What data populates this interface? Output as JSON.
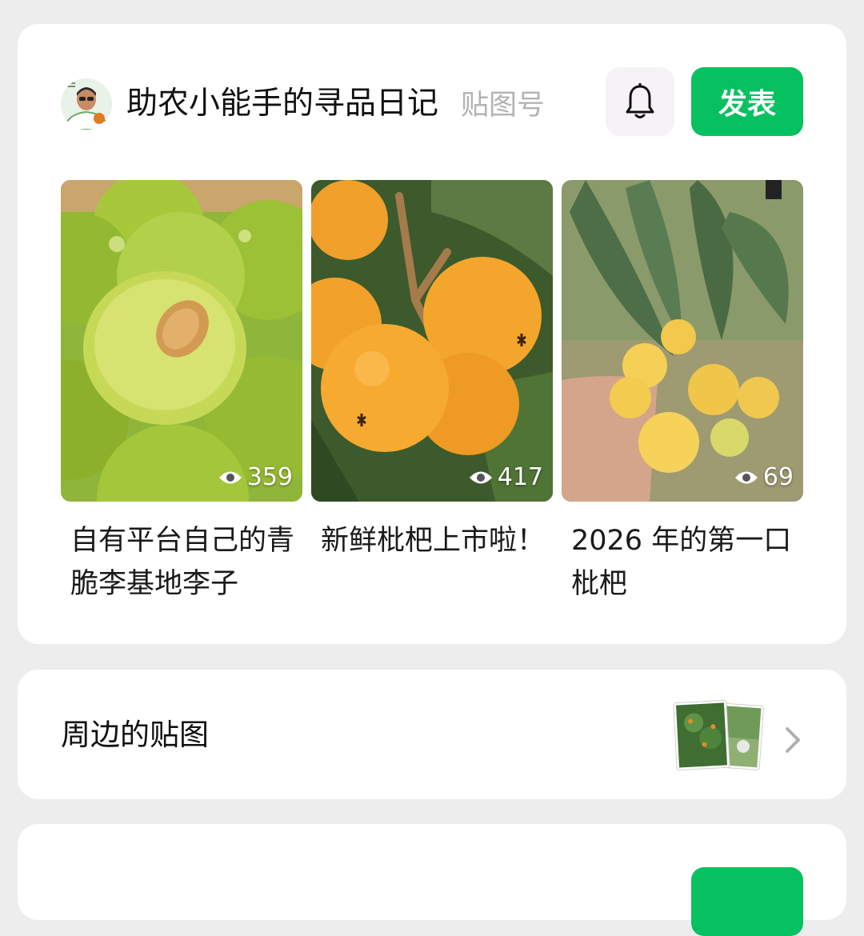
{
  "account": {
    "name": "助农小能手的寻品日记",
    "type": "贴图号",
    "bell_icon": "bell-icon",
    "publish_label": "发表",
    "accent": "#07c160"
  },
  "posts": [
    {
      "title": "自有平台自己的青脆李基地李子",
      "views": "359",
      "image": "green-plums"
    },
    {
      "title": "新鲜枇杷上市啦！",
      "views": "417",
      "image": "loquat-cluster"
    },
    {
      "title": "2026 年的第一口枇杷",
      "views": "69",
      "image": "loquat-in-hand"
    }
  ],
  "nearby": {
    "label": "周边的贴图",
    "chevron_icon": "chevron-right-icon"
  }
}
